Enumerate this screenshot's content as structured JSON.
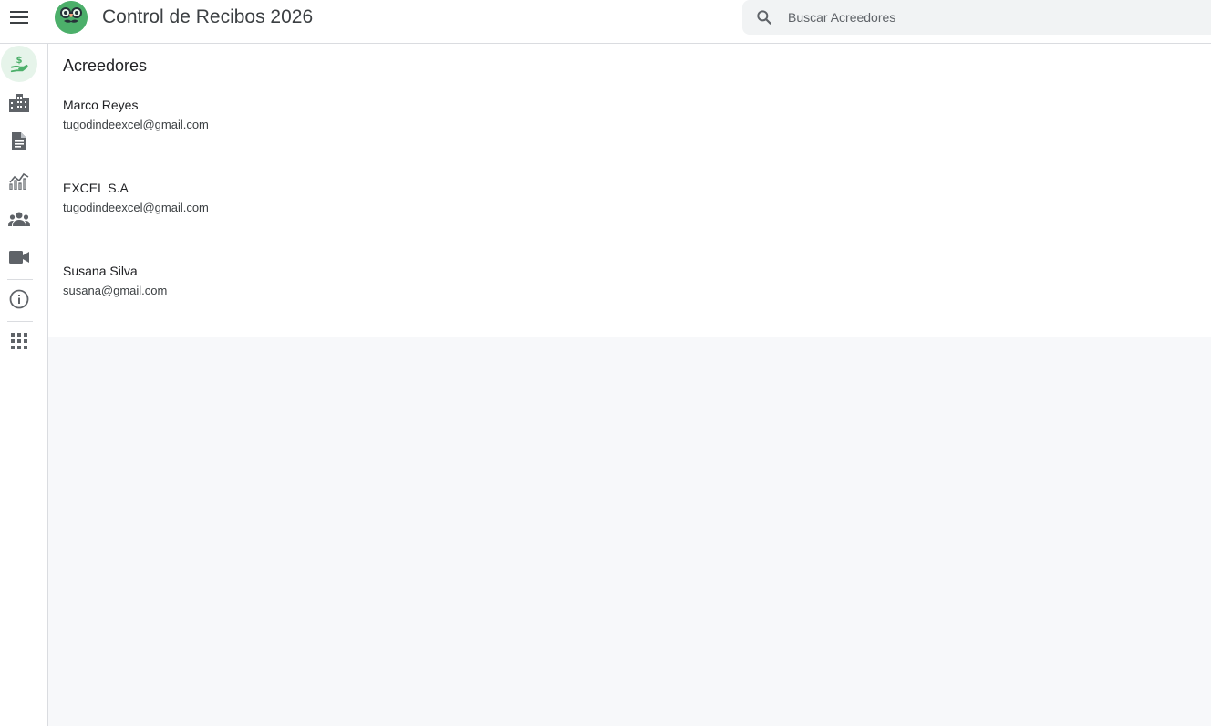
{
  "app": {
    "title": "Control de Recibos 2026"
  },
  "search": {
    "placeholder": "Buscar Acreedores",
    "value": ""
  },
  "page": {
    "title": "Acreedores"
  },
  "sidebar": {
    "items": [
      {
        "icon": "hand-money-icon",
        "active": true
      },
      {
        "icon": "building-icon",
        "active": false
      },
      {
        "icon": "document-icon",
        "active": false
      },
      {
        "icon": "chart-icon",
        "active": false
      },
      {
        "icon": "people-icon",
        "active": false
      },
      {
        "icon": "video-icon",
        "active": false
      },
      {
        "icon": "info-icon",
        "active": false
      },
      {
        "icon": "apps-grid-icon",
        "active": false
      }
    ]
  },
  "creditors": [
    {
      "name": "Marco Reyes",
      "email": "tugodindeexcel@gmail.com"
    },
    {
      "name": "EXCEL S.A",
      "email": "tugodindeexcel@gmail.com"
    },
    {
      "name": "Susana Silva",
      "email": "susana@gmail.com"
    }
  ],
  "colors": {
    "accent": "#4caf6a",
    "active_bg": "#e6f4ea",
    "icon_gray": "#5f6368",
    "content_bg": "#f7f8fa"
  }
}
